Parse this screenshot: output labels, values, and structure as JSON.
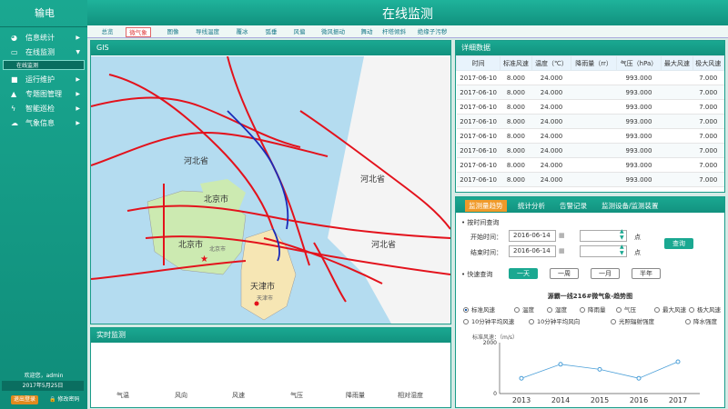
{
  "sidebar": {
    "app_title": "输电",
    "items": [
      {
        "label": "信息统计",
        "icon": "pie-chart-icon"
      },
      {
        "label": "在线监测",
        "icon": "monitor-icon"
      },
      {
        "label": "运行维护",
        "icon": "camera-icon"
      },
      {
        "label": "专题图管理",
        "icon": "bell-icon"
      },
      {
        "label": "智能巡检",
        "icon": "lightning-icon"
      },
      {
        "label": "气象信息",
        "icon": "weather-icon"
      }
    ],
    "sub_item": "在线监测",
    "welcome": "欢迎您，admin",
    "date": "2017年5月25日",
    "logout": "退出登录",
    "change_password": "修改密码"
  },
  "header": {
    "title": "在线监测"
  },
  "tabs": [
    "总览",
    "微气象",
    "图像",
    "导线温度",
    "覆冰",
    "弧垂",
    "风偏",
    "微风振动",
    "舞动",
    "杆塔倾斜",
    "绝缘子污秽"
  ],
  "gis": {
    "title": "GIS",
    "map_labels": [
      "河北省",
      "河北省",
      "北京市",
      "北京市",
      "北京市",
      "天津市",
      "天津市",
      "河北省"
    ]
  },
  "realtime": {
    "title": "实时监测",
    "labels": [
      "气温",
      "风向",
      "风速",
      "气压",
      "降雨量",
      "相对湿度"
    ]
  },
  "detail": {
    "title": "详细数据",
    "columns": [
      "时间",
      "标准风速",
      "温度（℃）",
      "降雨量（rr）",
      "气压（hPa）",
      "最大风速",
      "极大风速"
    ],
    "rows": [
      [
        "2017-06-10",
        "8.000",
        "24.000",
        "",
        "993.000",
        "",
        "7.000"
      ],
      [
        "2017-06-10",
        "8.000",
        "24.000",
        "",
        "993.000",
        "",
        "7.000"
      ],
      [
        "2017-06-10",
        "8.000",
        "24.000",
        "",
        "993.000",
        "",
        "7.000"
      ],
      [
        "2017-06-10",
        "8.000",
        "24.000",
        "",
        "993.000",
        "",
        "7.000"
      ],
      [
        "2017-06-10",
        "8.000",
        "24.000",
        "",
        "993.000",
        "",
        "7.000"
      ],
      [
        "2017-06-10",
        "8.000",
        "24.000",
        "",
        "993.000",
        "",
        "7.000"
      ],
      [
        "2017-06-10",
        "8.000",
        "24.000",
        "",
        "993.000",
        "",
        "7.000"
      ],
      [
        "2017-06-10",
        "8.000",
        "24.000",
        "",
        "993.000",
        "",
        "7.000"
      ]
    ]
  },
  "trend": {
    "tabs": [
      "监测量趋势",
      "统计分析",
      "告警记录",
      "监测设备/监测装置"
    ],
    "by_time": "按时间查询",
    "start_label": "开始时间：",
    "start_value": "2016-06-14",
    "end_label": "结束时间：",
    "end_value": "2016-06-14",
    "point": "点",
    "query": "查询",
    "quick": "快速查询",
    "quick_buttons": [
      "一天",
      "一周",
      "一月",
      "半年"
    ],
    "chart_title": "源霸一线216#微气象-趋势图",
    "radios": [
      "标准风速",
      "温度",
      "湿度",
      "降雨量",
      "气压",
      "最大风速",
      "极大风速",
      "10分钟平均风速",
      "10分钟平均风向",
      "光照辐射强度",
      "降水强度"
    ]
  },
  "chart_data": {
    "type": "line",
    "title": "源霸一线216#微气象-趋势图",
    "ylabel": "标准风速：（m/s）",
    "categories": [
      "2013",
      "2014",
      "2015",
      "2016",
      "2017"
    ],
    "values": [
      600,
      1150,
      950,
      600,
      1250
    ],
    "ylim": [
      0,
      2000
    ],
    "yticks": [
      0,
      2000
    ],
    "series_color": "#4a9fd8"
  }
}
